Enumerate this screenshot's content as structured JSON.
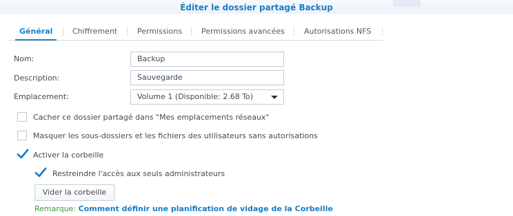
{
  "dialog": {
    "title": "Éditer le dossier partagé Backup"
  },
  "tabs": [
    {
      "label": "Général",
      "active": true
    },
    {
      "label": "Chiffrement",
      "active": false
    },
    {
      "label": "Permissions",
      "active": false
    },
    {
      "label": "Permissions avancées",
      "active": false
    },
    {
      "label": "Autorisations NFS",
      "active": false
    }
  ],
  "form": {
    "name": {
      "label": "Nom:",
      "value": "Backup"
    },
    "description": {
      "label": "Description:",
      "value": "Sauvegarde"
    },
    "location": {
      "label": "Emplacement:",
      "value": "Volume 1 (Disponible: 2.68 To)"
    }
  },
  "options": {
    "hide_network": {
      "label": "Cacher ce dossier partagé dans \"Mes emplacements réseaux\"",
      "checked": false
    },
    "hide_subfolders": {
      "label": "Masquer les sous-dossiers et les fichiers des utilisateurs sans autorisations",
      "checked": false
    },
    "recycle_bin": {
      "label": "Activer la corbeille",
      "checked": true
    },
    "restrict_admins": {
      "label": "Restreindre l'accès aux seuls administrateurs",
      "checked": true
    }
  },
  "empty_bin_button": {
    "label": "Vider la corbeille"
  },
  "note": {
    "prefix": "Remarque:",
    "link": "Comment définir une planification de vidage de la Corbeille"
  },
  "colors": {
    "accent": "#1b7dc4",
    "note_green": "#3a9a3a",
    "text": "#414b55"
  }
}
